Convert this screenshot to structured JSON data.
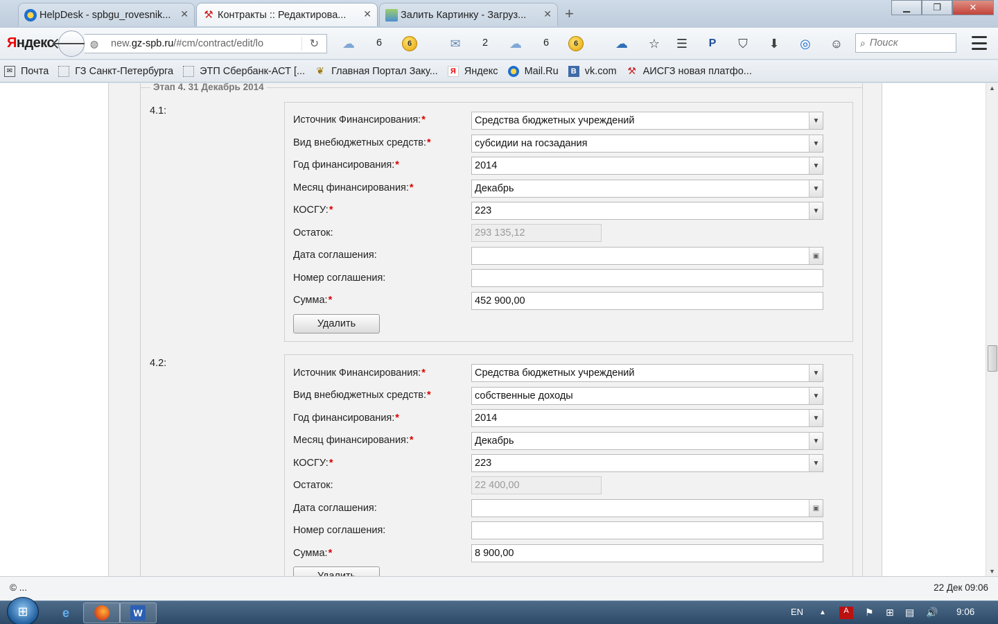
{
  "browser": {
    "tabs": [
      {
        "title": "HelpDesk - spbgu_rovesnik...",
        "icon": "mailru-icon"
      },
      {
        "title": "Контракты :: Редактирова...",
        "icon": "tools-icon"
      },
      {
        "title": "Залить Картинку - Загруз...",
        "icon": "image-icon"
      }
    ],
    "new_tab_glyph": "+",
    "url_host": "new.gz-spb.ru",
    "url_pre": "new.",
    "url_domain": "gz-spb.ru",
    "url_path": "/#cm/contract/edit/lo",
    "logo_first": "Я",
    "logo_rest": "ндекс",
    "toolbar_counts": {
      "cloud1": "6",
      "mail": "2",
      "cloud2": "6"
    },
    "coin_label": "6",
    "search_placeholder": "Поиск"
  },
  "bookmarks": [
    {
      "label": "Почта",
      "icon": "mail-icon"
    },
    {
      "label": "ГЗ Санкт-Петербурга",
      "icon": "page-icon"
    },
    {
      "label": "ЭТП Сбербанк-АСТ [...",
      "icon": "page-icon"
    },
    {
      "label": "Главная Портал Заку...",
      "icon": "emblem-icon"
    },
    {
      "label": "Яндекс",
      "icon": "yandex-icon"
    },
    {
      "label": "Mail.Ru",
      "icon": "mailru-icon"
    },
    {
      "label": "vk.com",
      "icon": "vk-icon"
    },
    {
      "label": "АИСГЗ новая платфо...",
      "icon": "tools-icon"
    }
  ],
  "stage": {
    "legend": "Этап 4. 31 Декабрь 2014"
  },
  "labels": {
    "source": "Источник Финансирования:",
    "extra_type": "Вид внебюджетных средств:",
    "year": "Год финансирования:",
    "month": "Месяц финансирования:",
    "kosgu": "КОСГУ:",
    "balance": "Остаток:",
    "agreement_date": "Дата соглашения:",
    "agreement_number": "Номер соглашения:",
    "sum": "Сумма:",
    "required_mark": "*",
    "delete_button": "Удалить"
  },
  "subsections": [
    {
      "number": "4.1:",
      "source": "Средства бюджетных учреждений",
      "extra_type": "субсидии на госзадания",
      "year": "2014",
      "month": "Декабрь",
      "kosgu": "223",
      "balance": "293 135,12",
      "agreement_date": "",
      "agreement_number": "",
      "sum": "452 900,00"
    },
    {
      "number": "4.2:",
      "source": "Средства бюджетных учреждений",
      "extra_type": "собственные доходы",
      "year": "2014",
      "month": "Декабрь",
      "kosgu": "223",
      "balance": "22 400,00",
      "agreement_date": "",
      "agreement_number": "",
      "sum": "8 900,00"
    }
  ],
  "statusbar": {
    "left": "© ...",
    "right": "22 Дек 09:06"
  },
  "taskbar": {
    "lang": "EN",
    "time": "9:06"
  },
  "colors": {
    "required": "#dd0000",
    "panel_bg": "#f2f2f2"
  }
}
